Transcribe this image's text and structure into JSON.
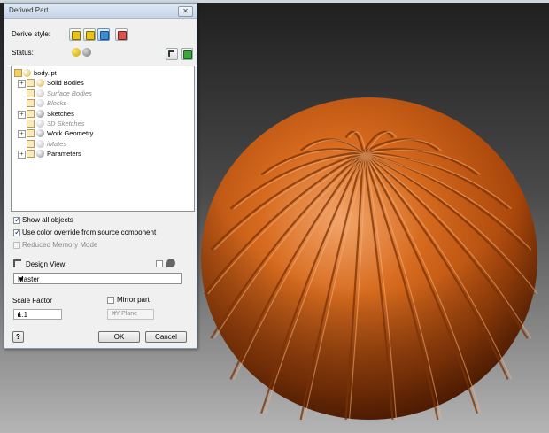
{
  "dialog": {
    "title": "Derived Part",
    "close_glyph": "✕",
    "derive_style_label": "Derive style:",
    "status_label": "Status:",
    "tree": [
      {
        "label": "body.ipt",
        "expander": "",
        "disabled": false,
        "icon": "part-file-icon"
      },
      {
        "label": "Solid Bodies",
        "expander": "+",
        "disabled": false,
        "icon": "solid-bodies-icon"
      },
      {
        "label": "Surface Bodies",
        "expander": "",
        "disabled": true,
        "icon": "surface-bodies-icon"
      },
      {
        "label": "Blocks",
        "expander": "",
        "disabled": true,
        "icon": "blocks-icon"
      },
      {
        "label": "Sketches",
        "expander": "+",
        "disabled": false,
        "icon": "sketches-icon"
      },
      {
        "label": "3D Sketches",
        "expander": "",
        "disabled": true,
        "icon": "3d-sketches-icon"
      },
      {
        "label": "Work Geometry",
        "expander": "+",
        "disabled": false,
        "icon": "work-geometry-icon"
      },
      {
        "label": "iMates",
        "expander": "",
        "disabled": true,
        "icon": "imates-icon"
      },
      {
        "label": "Parameters",
        "expander": "+",
        "disabled": false,
        "icon": "parameters-icon"
      }
    ],
    "show_all_objects": {
      "label": "Show all objects",
      "checked": true
    },
    "use_color_override": {
      "label": "Use color override from source component",
      "checked": true
    },
    "reduced_memory": {
      "label": "Reduced Memory Mode",
      "checked": false,
      "disabled": true
    },
    "design_view_label": "Design View:",
    "design_view_value": "Master",
    "scale_factor_label": "Scale Factor",
    "scale_factor_value": "1.1",
    "mirror_part": {
      "label": "Mirror part",
      "checked": false
    },
    "mirror_plane_value": "XY Plane",
    "ok_label": "OK",
    "cancel_label": "Cancel",
    "help_glyph": "?"
  },
  "colors": {
    "part_orange": "#c2560f",
    "part_highlight": "#f0a062",
    "part_shadow": "#6e2a05",
    "selected_button": "#b9d4f1"
  }
}
